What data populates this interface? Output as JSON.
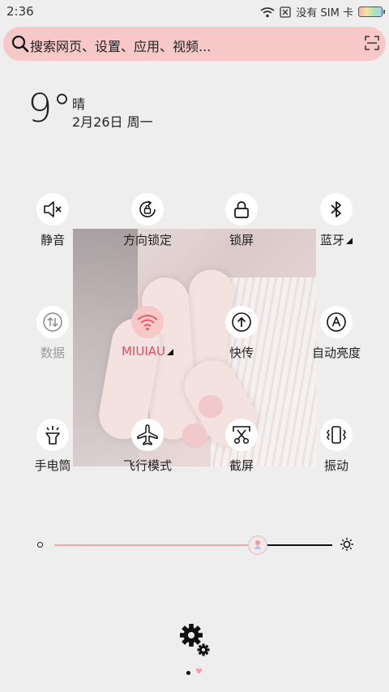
{
  "status": {
    "time": "2:36",
    "carrier": "没有 SIM 卡"
  },
  "search": {
    "placeholder": "搜索网页、设置、应用、视频..."
  },
  "weather": {
    "temp": "9°",
    "condition": "晴",
    "date": "2月26日 周一"
  },
  "tiles": [
    {
      "label": "静音",
      "icon": "mute-icon"
    },
    {
      "label": "方向锁定",
      "icon": "rotation-lock-icon"
    },
    {
      "label": "锁屏",
      "icon": "lock-icon"
    },
    {
      "label": "蓝牙",
      "icon": "bluetooth-icon"
    },
    {
      "label": "数据",
      "icon": "data-icon"
    },
    {
      "label": "MIUIAU",
      "icon": "wifi-icon"
    },
    {
      "label": "快传",
      "icon": "upload-icon"
    },
    {
      "label": "自动亮度",
      "icon": "auto-brightness-icon"
    },
    {
      "label": "手电筒",
      "icon": "flashlight-icon"
    },
    {
      "label": "飞行模式",
      "icon": "airplane-icon"
    },
    {
      "label": "截屏",
      "icon": "screenshot-icon"
    },
    {
      "label": "振动",
      "icon": "vibrate-icon"
    }
  ],
  "brightness": {
    "level": 0.73
  },
  "colors": {
    "accent": "#f7c8c8",
    "active_label": "#e05060"
  },
  "pager": {
    "current": 1,
    "total": 2
  }
}
